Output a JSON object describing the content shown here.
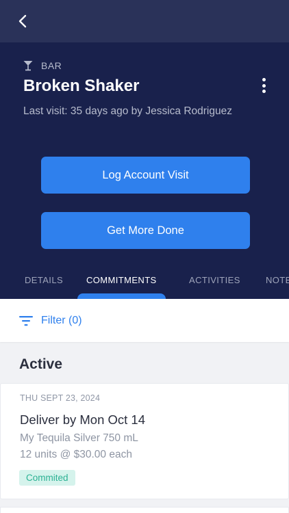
{
  "header": {
    "back_icon": "chevron-left-icon"
  },
  "account": {
    "type_icon": "cocktail-glass-icon",
    "type": "BAR",
    "name": "Broken Shaker",
    "last_visit": "Last visit: 35 days ago by Jessica Rodriguez",
    "menu_icon": "kebab-menu-icon"
  },
  "actions": {
    "log_visit_label": "Log Account Visit",
    "get_more_done_label": "Get More Done"
  },
  "tabs": [
    {
      "label": "DETAILS",
      "active": false
    },
    {
      "label": "COMMITMENTS",
      "active": true
    },
    {
      "label": "ACTIVITIES",
      "active": false
    },
    {
      "label": "NOTES",
      "active": false
    }
  ],
  "filter": {
    "icon": "filter-icon",
    "label": "Filter (0)"
  },
  "section": {
    "title": "Active"
  },
  "commitments": [
    {
      "date": "THU SEPT 23, 2024",
      "title": "Deliver by Mon Oct 14",
      "product": "My Tequila Silver 750 mL",
      "quantity": "12 units @ $30.00 each",
      "status": "Commited"
    }
  ],
  "colors": {
    "accent": "#2f80ed",
    "hero_bg": "#19214c",
    "topbar_bg": "#2a3259",
    "status_bg": "#d5f3ec",
    "status_text": "#2bb193"
  }
}
